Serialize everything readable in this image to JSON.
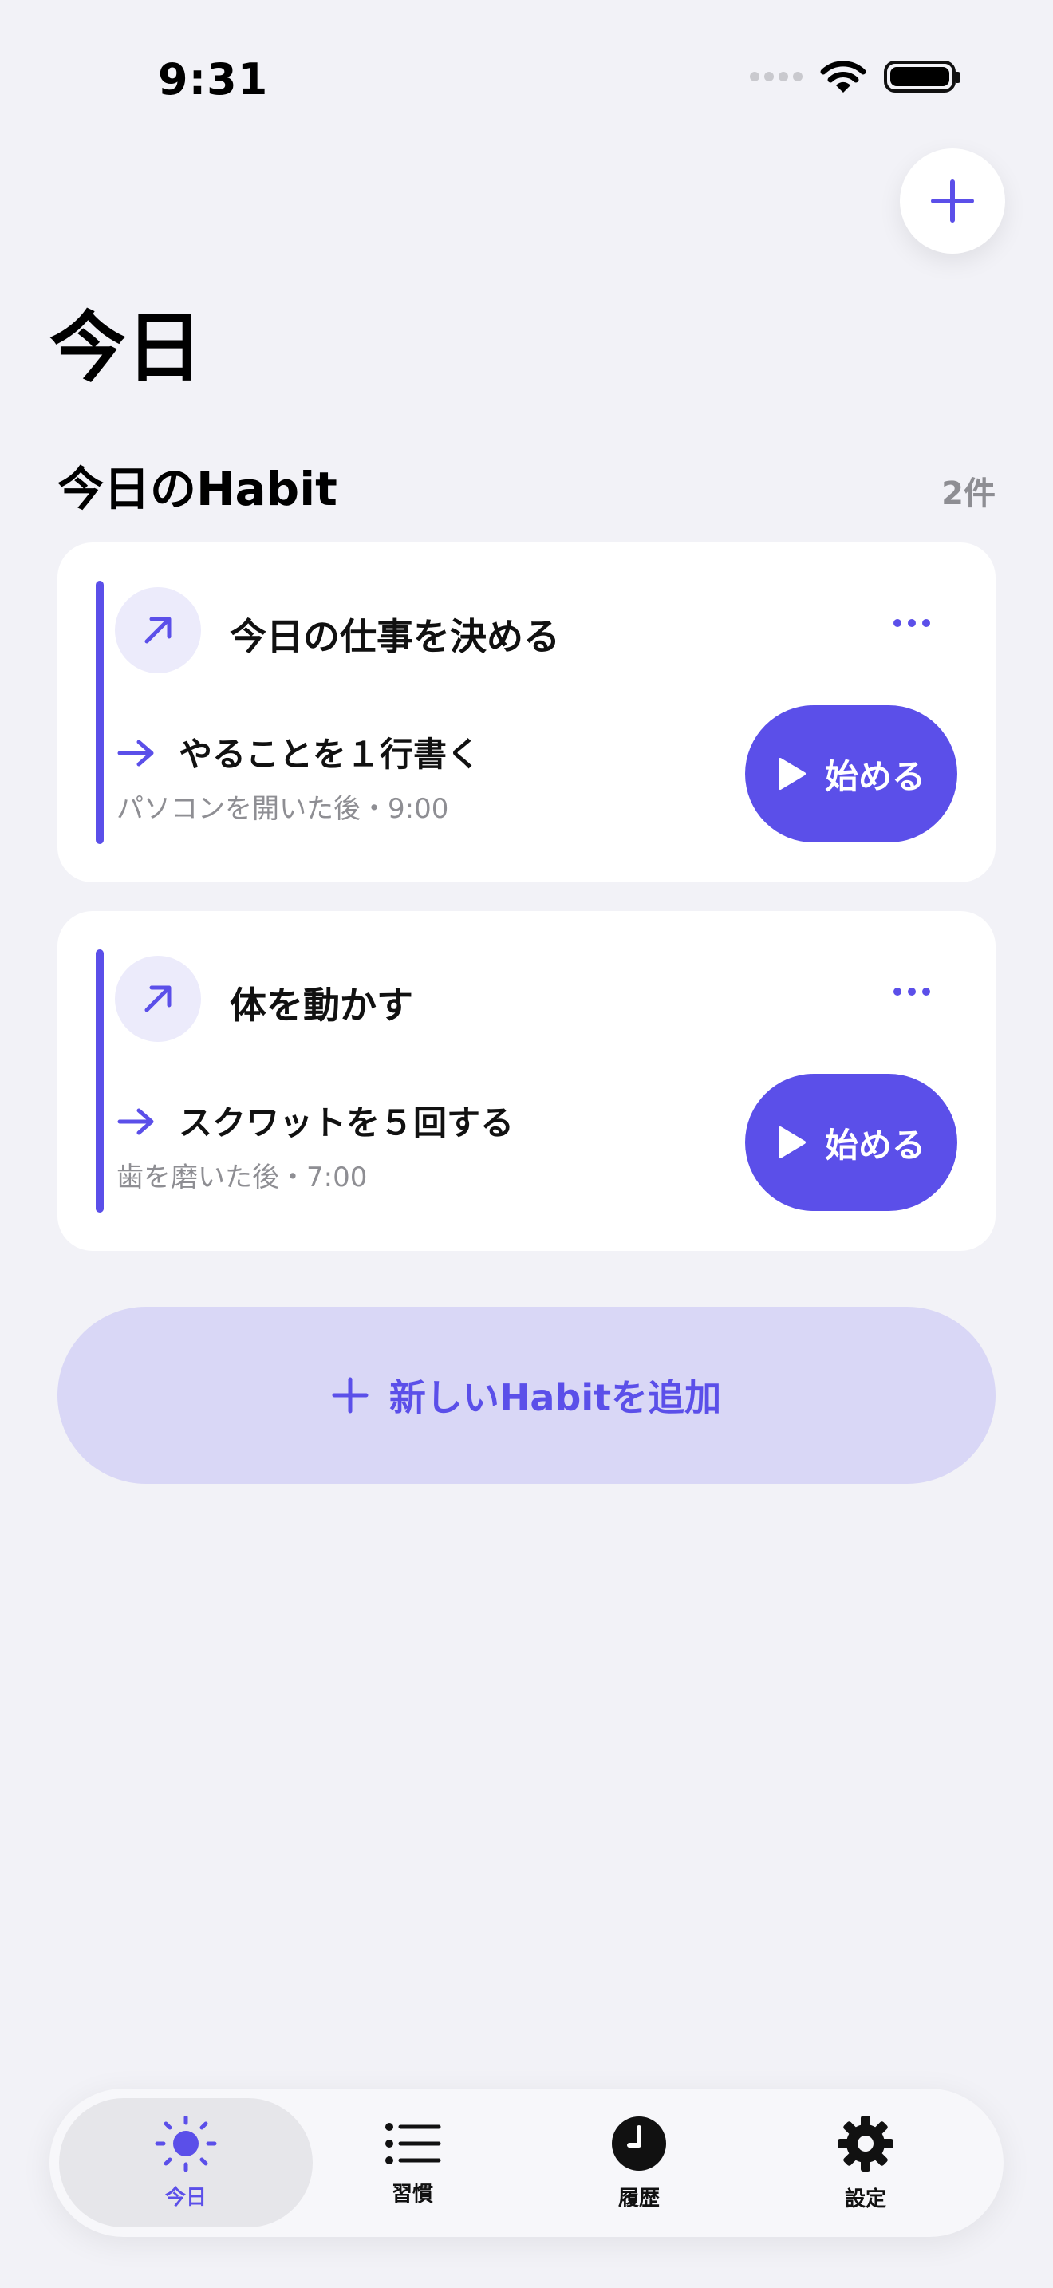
{
  "status_bar": {
    "time": "9:31"
  },
  "header": {
    "title": "今日"
  },
  "section": {
    "title": "今日のHabit",
    "count": "2件"
  },
  "habits": [
    {
      "title": "今日の仕事を決める",
      "step": "やることを１行書く",
      "meta": "パソコンを開いた後・9:00",
      "start_label": "始める",
      "icon": "arrow-up-right-icon"
    },
    {
      "title": "体を動かす",
      "step": "スクワットを５回する",
      "meta": "歯を磨いた後・7:00",
      "start_label": "始める",
      "icon": "arrow-up-right-icon"
    }
  ],
  "add_habit": {
    "label": "新しいHabitを追加"
  },
  "tabs": [
    {
      "label": "今日",
      "icon": "sun-icon",
      "active": true
    },
    {
      "label": "習慣",
      "icon": "list-icon",
      "active": false
    },
    {
      "label": "履歴",
      "icon": "clock-icon",
      "active": false
    },
    {
      "label": "設定",
      "icon": "gear-icon",
      "active": false
    }
  ],
  "colors": {
    "accent": "#5B4FE9",
    "background": "#F2F2F7",
    "accent_soft": "#D9D7F6"
  }
}
